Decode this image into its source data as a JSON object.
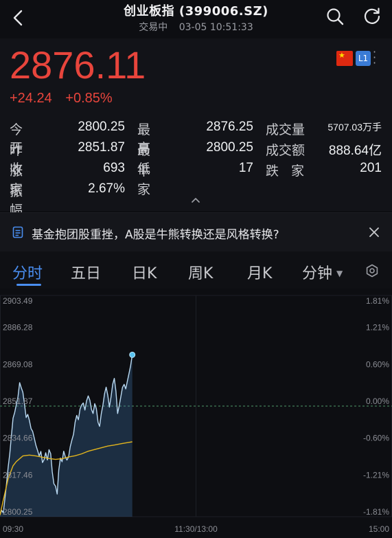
{
  "header": {
    "title": "创业板指 (399006.SZ)",
    "status": "交易中",
    "datetime": "03-05 10:51:33",
    "icons": [
      "back-icon",
      "search-icon",
      "refresh-icon"
    ]
  },
  "quote": {
    "price": "2876.11",
    "change": "+24.24",
    "change_pct": "+0.85%",
    "up_color": "#e8453c",
    "level_badge": "L1",
    "rows": [
      [
        {
          "label": "今开",
          "value": "2800.25"
        },
        {
          "label": "最高",
          "value": "2876.25"
        },
        {
          "label": "成交量",
          "value": "5707.03",
          "unit": "万手"
        }
      ],
      [
        {
          "label": "昨收",
          "value": "2851.87"
        },
        {
          "label": "最低",
          "value": "2800.25"
        },
        {
          "label": "成交额",
          "value": "888.64亿"
        }
      ],
      [
        {
          "label": "涨家",
          "value": "693"
        },
        {
          "label": "平家",
          "value": "17"
        },
        {
          "label": "跌家",
          "value": "201"
        }
      ],
      [
        {
          "label": "振幅",
          "value": "2.67%"
        }
      ]
    ]
  },
  "news": {
    "text": "基金抱团股重挫，A股是牛熊转换还是风格转换?"
  },
  "tabs": [
    {
      "label": "分时",
      "active": true
    },
    {
      "label": "五日"
    },
    {
      "label": "日K"
    },
    {
      "label": "周K"
    },
    {
      "label": "月K"
    },
    {
      "label": "分钟",
      "dropdown": true
    }
  ],
  "accent_color": "#4a8ef0",
  "chart_data": {
    "type": "line",
    "y_left_ticks": [
      "2903.49",
      "2886.28",
      "2869.08",
      "2851.87",
      "2834.66",
      "2817.46",
      "2800.25"
    ],
    "y_right_ticks": [
      "1.81%",
      "1.21%",
      "0.60%",
      "0.00%",
      "-0.60%",
      "-1.21%",
      "-1.81%"
    ],
    "x_ticks": [
      "09:30",
      "11:30/13:00",
      "15:00"
    ],
    "ylim": [
      2800.25,
      2903.49
    ],
    "prev_close": 2851.87,
    "total_minutes": 240,
    "series": [
      {
        "role": "price",
        "color": "#b9d9f2",
        "x": [
          0,
          1,
          2,
          3,
          4,
          5,
          6,
          7,
          8,
          9,
          10,
          11,
          12,
          13,
          14,
          15,
          16,
          17,
          18,
          19,
          20,
          21,
          22,
          23,
          24,
          25,
          26,
          27,
          28,
          29,
          30,
          31,
          32,
          33,
          34,
          35,
          36,
          37,
          38,
          39,
          40,
          41,
          42,
          43,
          44,
          45,
          46,
          47,
          48,
          49,
          50,
          51,
          52,
          53,
          54,
          55,
          56,
          57,
          58,
          59,
          60,
          61,
          62,
          63,
          64,
          65,
          66,
          67,
          68,
          69,
          70,
          71,
          72,
          73,
          74,
          75,
          76,
          77,
          78,
          79,
          80,
          81
        ],
        "values": [
          2801.4,
          2803.2,
          2802.1,
          2808.5,
          2815.6,
          2823.4,
          2829.8,
          2838.3,
          2846.2,
          2848.9,
          2852.6,
          2856.2,
          2862.8,
          2860.5,
          2858.3,
          2852.6,
          2846.5,
          2848.0,
          2845.2,
          2841.4,
          2840.0,
          2836.8,
          2833.6,
          2831.2,
          2828.6,
          2830.7,
          2825.5,
          2826.9,
          2830.1,
          2826.7,
          2831.5,
          2829.7,
          2821.2,
          2815.6,
          2814.5,
          2810.8,
          2822.0,
          2827.6,
          2825.9,
          2830.8,
          2828.1,
          2826.7,
          2828.1,
          2832.9,
          2836.0,
          2838.7,
          2844.3,
          2847.5,
          2845.5,
          2850.5,
          2852.4,
          2853.3,
          2850.0,
          2854.3,
          2856.6,
          2854.6,
          2850.3,
          2848.4,
          2853.0,
          2850.6,
          2844.3,
          2842.4,
          2848.2,
          2852.3,
          2857.6,
          2860.7,
          2856.9,
          2851.4,
          2856.3,
          2862.1,
          2864.8,
          2858.7,
          2848.4,
          2852.1,
          2856.4,
          2860.6,
          2862.0,
          2859.9,
          2863.6,
          2867.2,
          2870.8,
          2875.8
        ]
      },
      {
        "role": "average",
        "color": "#e3b51d",
        "x": [
          0,
          2,
          5,
          8,
          10,
          14,
          18,
          22,
          26,
          30,
          34,
          38,
          42,
          46,
          50,
          54,
          58,
          62,
          66,
          70,
          74,
          78,
          81
        ],
        "values": [
          2801.0,
          2808.0,
          2818.0,
          2824.0,
          2826.0,
          2828.6,
          2829.0,
          2828.6,
          2828.0,
          2827.4,
          2827.0,
          2827.3,
          2828.1,
          2828.7,
          2829.6,
          2830.8,
          2831.6,
          2832.4,
          2833.2,
          2833.7,
          2834.3,
          2834.8,
          2835.2
        ]
      }
    ]
  }
}
